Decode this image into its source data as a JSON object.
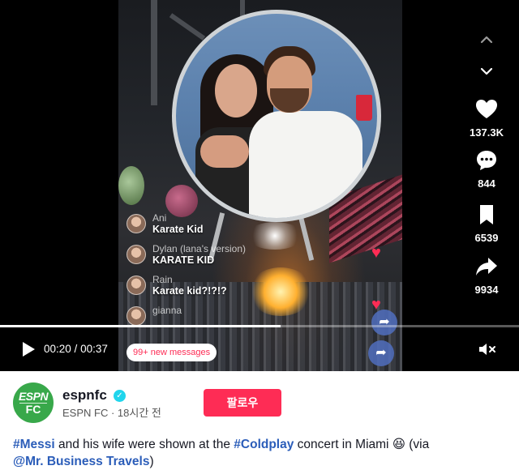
{
  "player": {
    "current_time": "00:20",
    "duration": "00:37",
    "time_separator": " / ",
    "progress": 0.54,
    "new_messages": "99+ new messages"
  },
  "chat": [
    {
      "name": "Ani",
      "text": "Karate Kid"
    },
    {
      "name": "Dylan (lana's version)",
      "text": "KARATE KID"
    },
    {
      "name": "Rain",
      "text": "Karate kid?!?!?"
    },
    {
      "name": "gianna",
      "text": ""
    }
  ],
  "actions": {
    "likes": "137.3K",
    "comments": "844",
    "saves": "6539",
    "shares": "9934"
  },
  "account": {
    "avatar_text_top": "ESPN",
    "avatar_text_bottom": "FC",
    "username": "espnfc",
    "display_name": "ESPN FC",
    "dot": " · ",
    "posted": "18시간 전",
    "follow_label": "팔로우"
  },
  "caption": {
    "tag1": "#Messi",
    "text1": " and his wife were shown at the ",
    "tag2": "#Coldplay",
    "text2": " concert in Miami 😆 (via",
    "mention": "@Mr. Business Travels",
    "text3": ")"
  },
  "icons": [
    "chevron-up-icon",
    "chevron-down-icon",
    "heart-icon",
    "comment-icon",
    "bookmark-icon",
    "share-icon",
    "play-icon",
    "mute-icon",
    "verified-icon"
  ],
  "colors": {
    "accent": "#fe2c55",
    "hashtag": "#2b5db9",
    "verified": "#20d5ec",
    "espn_green": "#38a84a"
  }
}
